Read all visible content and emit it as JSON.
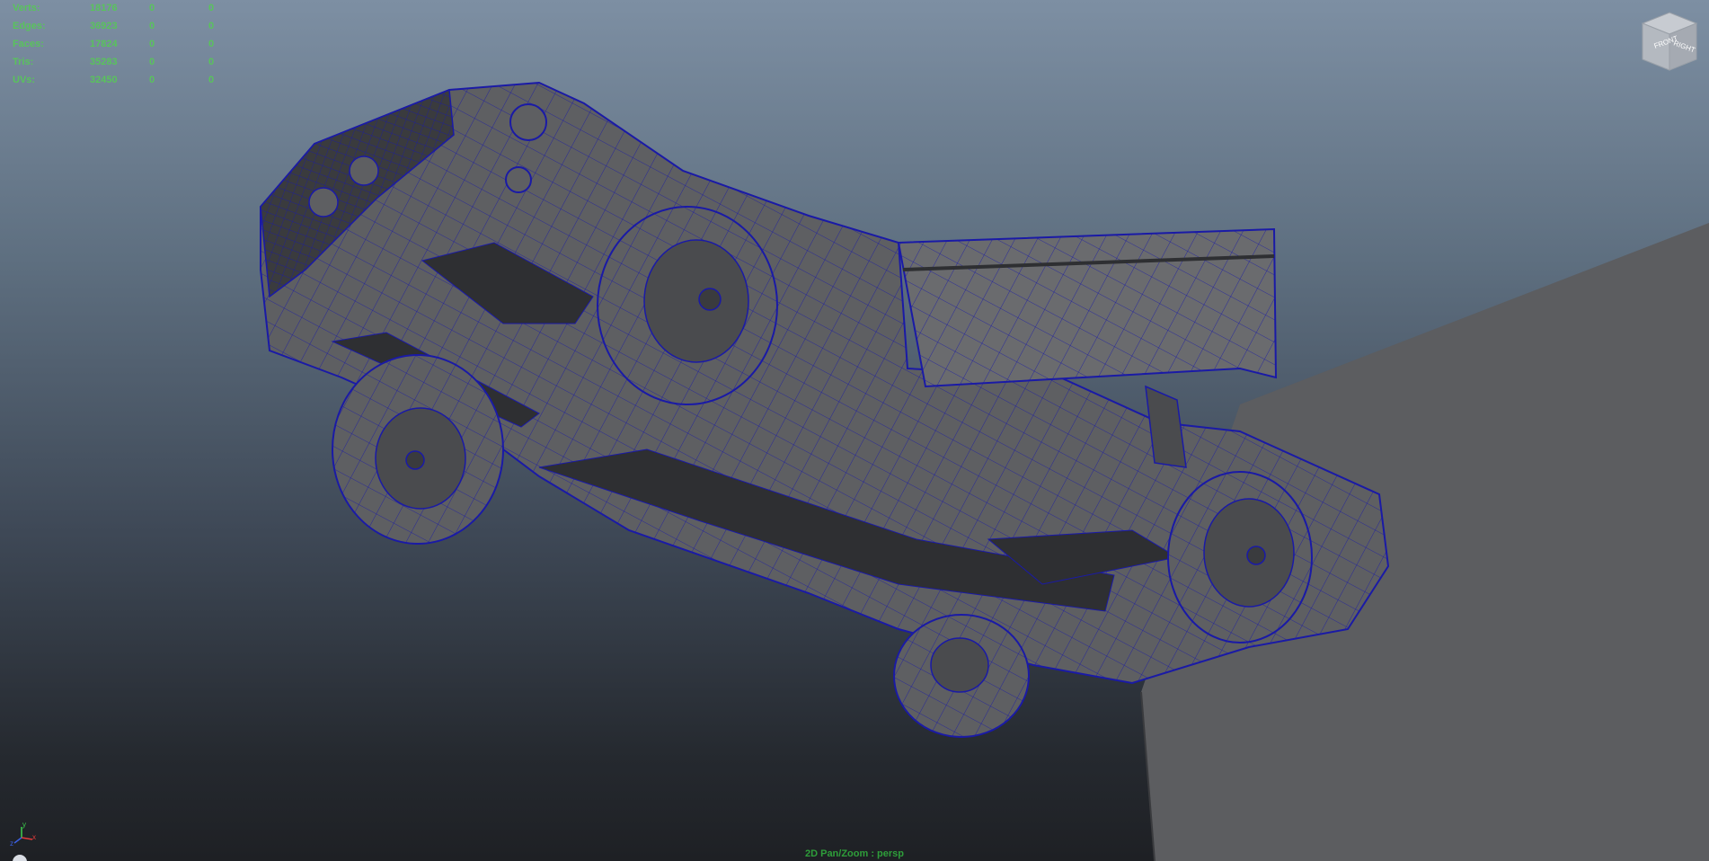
{
  "hud": {
    "rows": [
      {
        "label": "Verts:",
        "total": "18176",
        "selected": "0",
        "sel2": "0"
      },
      {
        "label": "Edges:",
        "total": "36923",
        "selected": "0",
        "sel2": "0"
      },
      {
        "label": "Faces:",
        "total": "17824",
        "selected": "0",
        "sel2": "0"
      },
      {
        "label": "Tris:",
        "total": "35283",
        "selected": "0",
        "sel2": "0"
      },
      {
        "label": "UVs:",
        "total": "32450",
        "selected": "0",
        "sel2": "0"
      }
    ]
  },
  "viewcube": {
    "front_label": "FRONT",
    "right_label": "RIGHT"
  },
  "axis": {
    "x_label": "x",
    "y_label": "y",
    "z_label": "z"
  },
  "camera_label": "2D Pan/Zoom : persp",
  "colors": {
    "hud_text": "#59c35c",
    "wire": "#1a1aa6",
    "mesh_fill": "#5e5f62",
    "mesh_dark": "#2e2f32",
    "ground": "#5c5d60"
  }
}
